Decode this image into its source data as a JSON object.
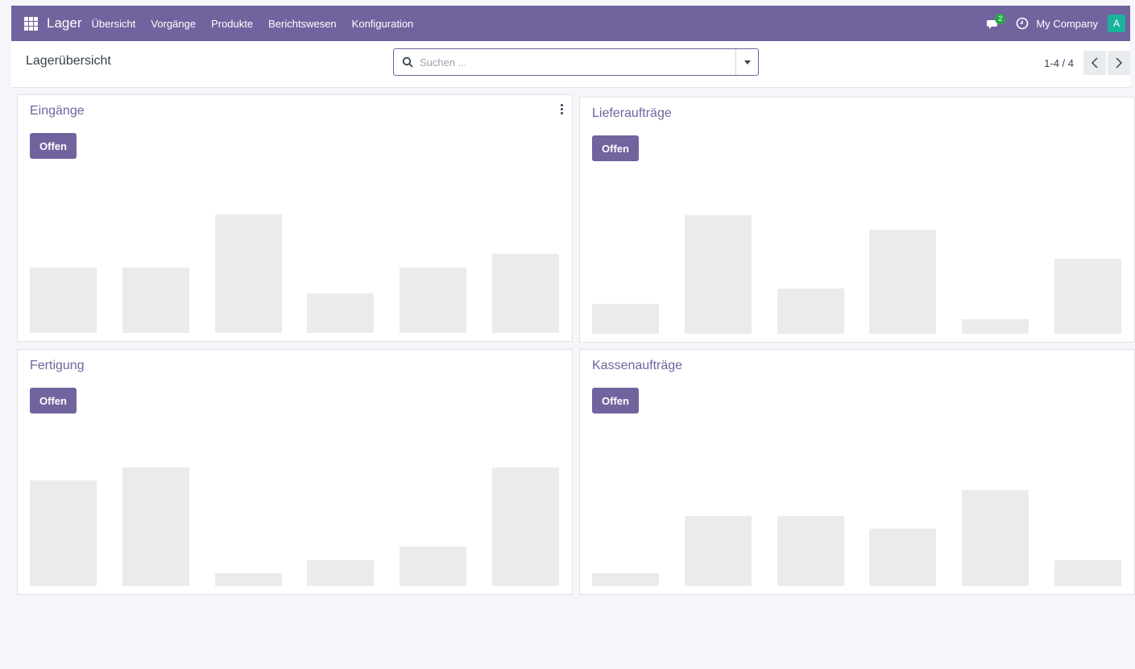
{
  "navbar": {
    "app_name": "Lager",
    "menu": [
      "Übersicht",
      "Vorgänge",
      "Produkte",
      "Berichtswesen",
      "Konfiguration"
    ],
    "chat_badge": "2",
    "company": "My Company",
    "avatar_letter": "A",
    "colors": {
      "bar": "#71639e",
      "avatar": "#1ab39f",
      "badge": "#28a745"
    }
  },
  "control_panel": {
    "title": "Lagerübersicht",
    "search_placeholder": "Suchen ...",
    "pager_value": "1-4 / 4",
    "prev_icon": "chevron-left-icon",
    "next_icon": "chevron-right-icon"
  },
  "cards": [
    {
      "title": "Eingänge",
      "button": "Offen",
      "has_menu": true,
      "bars": [
        0.55,
        0.55,
        1.0,
        0.33,
        0.55,
        0.67
      ]
    },
    {
      "title": "Lieferaufträge",
      "button": "Offen",
      "has_menu": false,
      "bars": [
        0.25,
        1.0,
        0.38,
        0.88,
        0.12,
        0.63
      ]
    },
    {
      "title": "Fertigung",
      "button": "Offen",
      "has_menu": false,
      "bars": [
        0.89,
        1.0,
        0.11,
        0.22,
        0.33,
        1.0
      ]
    },
    {
      "title": "Kassenaufträge",
      "button": "Offen",
      "has_menu": false,
      "bars": [
        0.11,
        0.59,
        0.59,
        0.48,
        0.81,
        0.22
      ]
    }
  ]
}
